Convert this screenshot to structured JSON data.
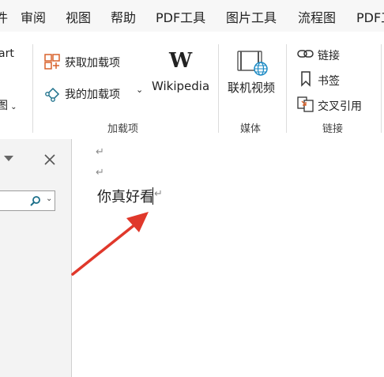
{
  "menubar": {
    "items": [
      {
        "label": "件"
      },
      {
        "label": "审阅"
      },
      {
        "label": "视图"
      },
      {
        "label": "帮助"
      },
      {
        "label": "PDF工具"
      },
      {
        "label": "图片工具"
      },
      {
        "label": "流程图"
      },
      {
        "label": "PDF工"
      }
    ]
  },
  "ribbon": {
    "partial_left": {
      "top": "art",
      "bottom": "图"
    },
    "addins": {
      "get_addins": "获取加载项",
      "my_addins": "我的加载项",
      "wikipedia": "Wikipedia",
      "wikipedia_glyph": "W",
      "group_label": "加载项"
    },
    "media": {
      "online_video": "联机视频",
      "group_label": "媒体"
    },
    "links": {
      "link": "链接",
      "bookmark": "书签",
      "cross_reference": "交叉引用",
      "group_label": "链接"
    }
  },
  "document": {
    "body_text": "你真好看",
    "paragraph_mark": "↵"
  },
  "colors": {
    "arrow": "#e0382b",
    "accent_orange": "#d9622b",
    "accent_teal": "#1b6f8a"
  },
  "icons": [
    "store-icon",
    "my-addins-icon",
    "wikipedia-icon",
    "online-video-icon",
    "link-icon",
    "bookmark-icon",
    "cross-reference-icon",
    "search-icon",
    "close-icon",
    "pane-menu-icon"
  ]
}
